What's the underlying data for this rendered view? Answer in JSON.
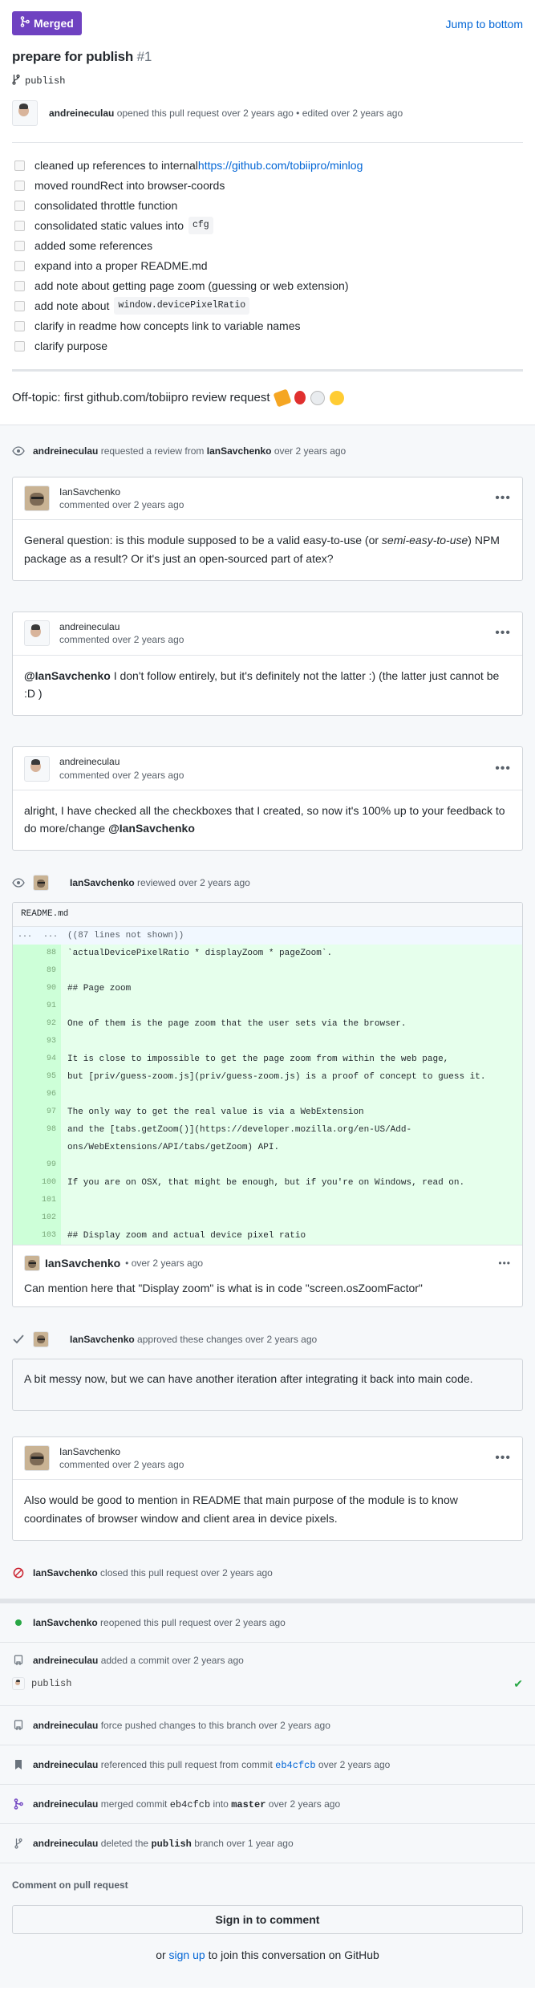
{
  "header": {
    "status": "Merged",
    "jump_label": "Jump to bottom",
    "title": "prepare for publish",
    "number": "#1",
    "branch": "publish"
  },
  "opener": {
    "user": "andreineculau",
    "text": "opened this pull request over 2 years ago • edited over 2 years ago"
  },
  "checklist": [
    {
      "text": "cleaned up references to internal ",
      "link": "https://github.com/tobiipro/minlog"
    },
    {
      "text": "moved roundRect into browser-coords"
    },
    {
      "text": "consolidated throttle function"
    },
    {
      "text": "consolidated static values into",
      "code": "cfg"
    },
    {
      "text": "added some references"
    },
    {
      "text": "expand into a proper README.md"
    },
    {
      "text": "add note about getting page zoom (guessing or web extension)"
    },
    {
      "text": "add note about",
      "code": "window.devicePixelRatio"
    },
    {
      "text": "clarify in readme how concepts link to variable names"
    },
    {
      "text": "clarify purpose"
    }
  ],
  "offtopic": "Off-topic: first github.com/tobiipro review request",
  "review_request": {
    "user": "andreineculau",
    "text": "requested a review from",
    "target": "IanSavchenko",
    "time": "over 2 years ago"
  },
  "comments": {
    "c1": {
      "user": "IanSavchenko",
      "time": "commented over 2 years ago",
      "body_a": "General question: is this module supposed to be a valid easy-to-use (or ",
      "body_em": "semi-easy-to-use",
      "body_b": ") NPM package as a result? Or it's just an open-sourced part of atex?"
    },
    "c2": {
      "user": "andreineculau",
      "time": "commented over 2 years ago",
      "mention": "@IanSavchenko",
      "body": " I don't follow entirely, but it's definitely not the latter :) (the latter just cannot be :D )"
    },
    "c3": {
      "user": "andreineculau",
      "time": "commented over 2 years ago",
      "body": "alright, I have checked all the checkboxes that I created, so now it's 100% up to your feedback to do more/change ",
      "mention": "@IanSavchenko"
    }
  },
  "review1": {
    "user": "IanSavchenko",
    "text": "reviewed over 2 years ago",
    "file": "README.md",
    "hunk": "((87 lines not shown))",
    "lines": [
      {
        "n": "88",
        "t": "`actualDevicePixelRatio * displayZoom * pageZoom`."
      },
      {
        "n": "89",
        "t": ""
      },
      {
        "n": "90",
        "t": "## Page zoom"
      },
      {
        "n": "91",
        "t": ""
      },
      {
        "n": "92",
        "t": "One of them is the page zoom that the user sets via the browser."
      },
      {
        "n": "93",
        "t": ""
      },
      {
        "n": "94",
        "t": "It is close to impossible to get the page zoom from within the web page,"
      },
      {
        "n": "95",
        "t": "but [priv/guess-zoom.js](priv/guess-zoom.js) is a proof of concept to guess it."
      },
      {
        "n": "96",
        "t": ""
      },
      {
        "n": "97",
        "t": "The only way to get the real value is via a WebExtension"
      },
      {
        "n": "98",
        "t": "and the [tabs.getZoom()](https://developer.mozilla.org/en-US/Add-ons/WebExtensions/API/tabs/getZoom) API."
      },
      {
        "n": "99",
        "t": ""
      },
      {
        "n": "100",
        "t": "If you are on OSX, that might be enough, but if you're on Windows, read on."
      },
      {
        "n": "101",
        "t": ""
      },
      {
        "n": "102",
        "t": ""
      },
      {
        "n": "103",
        "t": "## Display zoom and actual device pixel ratio"
      }
    ],
    "inline_user": "IanSavchenko",
    "inline_time": "• over 2 years ago",
    "inline_body": "Can mention here that \"Display zoom\" is what is in code \"screen.osZoomFactor\""
  },
  "approval": {
    "user": "IanSavchenko",
    "text": "approved these changes over 2 years ago",
    "body": "A bit messy now, but we can have another iteration after integrating it back into main code."
  },
  "c4": {
    "user": "IanSavchenko",
    "time": "commented over 2 years ago",
    "body": "Also would be good to mention in README that main purpose of the module is to know coordinates of browser window and client area in device pixels."
  },
  "events": {
    "closed": {
      "user": "IanSavchenko",
      "text": "closed this pull request over 2 years ago"
    },
    "reopened": {
      "user": "IanSavchenko",
      "text": "reopened this pull request over 2 years ago"
    },
    "commit": {
      "user": "andreineculau",
      "text": "added a commit over 2 years ago",
      "msg": "publish"
    },
    "force": {
      "user": "andreineculau",
      "text": "force pushed changes to this branch over 2 years ago"
    },
    "ref": {
      "user": "andreineculau",
      "text_a": "referenced this pull request from commit",
      "sha": "eb4cfcb",
      "text_b": "over 2 years ago"
    },
    "merged": {
      "user": "andreineculau",
      "text_a": "merged commit",
      "sha": "eb4cfcb",
      "text_b": "into",
      "branch": "master",
      "text_c": "over 2 years ago"
    },
    "deleted": {
      "user": "andreineculau",
      "text_a": "deleted the",
      "branch": "publish",
      "text_b": "branch over 1 year ago"
    }
  },
  "footer": {
    "heading": "Comment on pull request",
    "signin": "Sign in to comment",
    "join_a": "or",
    "join_link": "sign up",
    "join_b": "to join this conversation on GitHub"
  },
  "colors": {
    "merged": "#6f42c1",
    "link": "#0366d6",
    "add_bg": "#e6ffec",
    "success": "#28a745",
    "danger": "#cb2431"
  }
}
